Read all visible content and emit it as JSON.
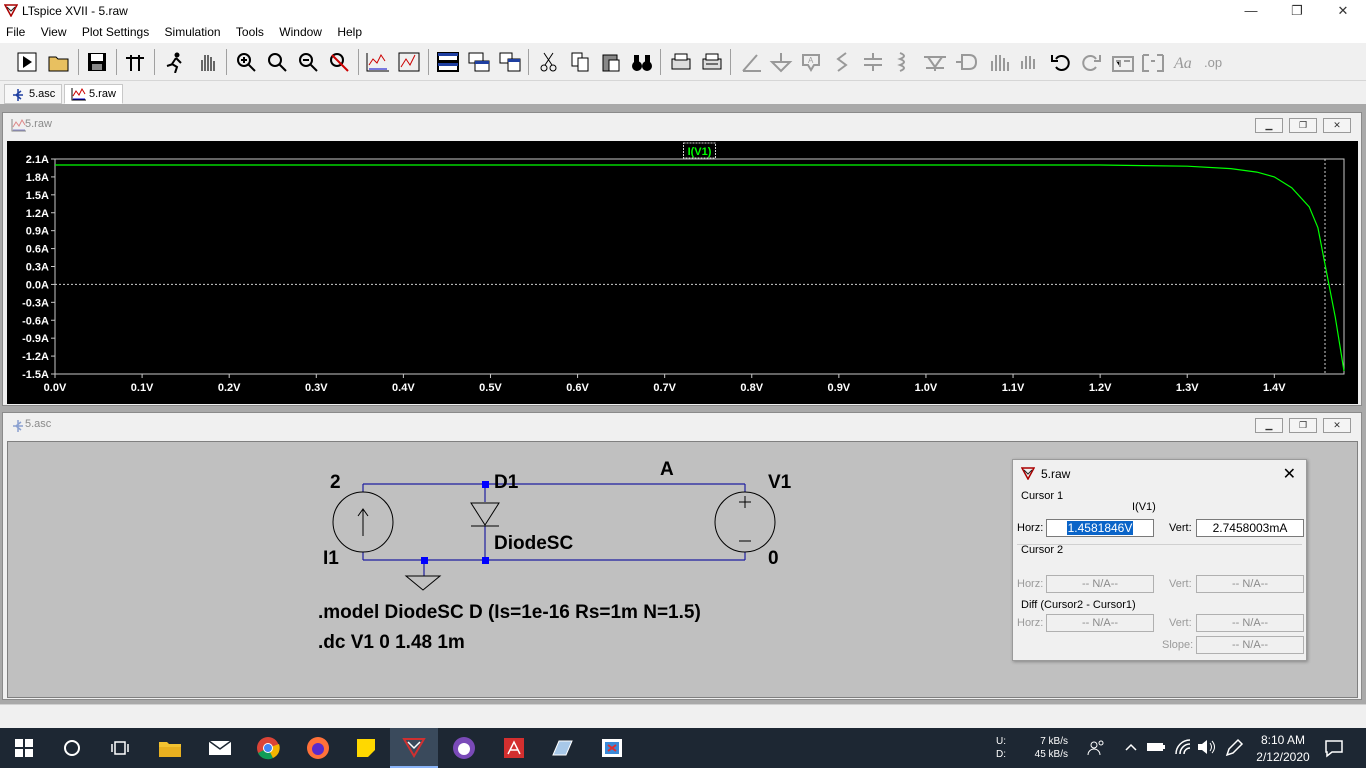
{
  "app": {
    "title": "LTspice XVII - 5.raw"
  },
  "window_controls": {
    "minimize": "—",
    "restore": "❐",
    "close": "✕"
  },
  "menu": [
    "File",
    "View",
    "Plot Settings",
    "Simulation",
    "Tools",
    "Window",
    "Help"
  ],
  "tabs": [
    {
      "label": "5.asc"
    },
    {
      "label": "5.raw"
    }
  ],
  "plot_window": {
    "title": "5.raw",
    "trace_label": "I(V1)"
  },
  "chart_data": {
    "type": "line",
    "series": [
      {
        "name": "I(V1)",
        "color": "#00ff00",
        "x": [
          0.0,
          0.2,
          0.4,
          0.6,
          0.8,
          1.0,
          1.1,
          1.2,
          1.25,
          1.3,
          1.35,
          1.38,
          1.4,
          1.42,
          1.44,
          1.45,
          1.46,
          1.47,
          1.48
        ],
        "y": [
          2.0,
          2.0,
          2.0,
          2.0,
          2.0,
          2.0,
          2.0,
          2.0,
          1.99,
          1.98,
          1.94,
          1.88,
          1.8,
          1.62,
          1.3,
          0.95,
          0.2,
          -0.55,
          -1.45
        ]
      }
    ],
    "yticks": [
      "2.1A",
      "1.8A",
      "1.5A",
      "1.2A",
      "0.9A",
      "0.6A",
      "0.3A",
      "0.0A",
      "-0.3A",
      "-0.6A",
      "-0.9A",
      "-1.2A",
      "-1.5A"
    ],
    "xticks": [
      "0.0V",
      "0.1V",
      "0.2V",
      "0.3V",
      "0.4V",
      "0.5V",
      "0.6V",
      "0.7V",
      "0.8V",
      "0.9V",
      "1.0V",
      "1.1V",
      "1.2V",
      "1.3V",
      "1.4V"
    ],
    "xlim": [
      0.0,
      1.48
    ],
    "ylim": [
      -1.5,
      2.1
    ],
    "cursor_x": 1.4581846,
    "zero_line": true
  },
  "schematic_window": {
    "title": "5.asc",
    "labels": {
      "node2": "2",
      "d1": "D1",
      "a": "A",
      "v1": "V1",
      "i1": "I1",
      "diode_model": "DiodeSC",
      "zero": "0"
    },
    "directives": [
      ".model DiodeSC D (Is=1e-16 Rs=1m N=1.5)",
      ".dc V1 0 1.48 1m"
    ]
  },
  "cursor_dialog": {
    "title": "5.raw",
    "close": "✕",
    "cursor1_label": "Cursor 1",
    "trace": "I(V1)",
    "horz_label": "Horz:",
    "vert_label": "Vert:",
    "c1_horz": "1.4581846V",
    "c1_vert": "2.7458003mA",
    "cursor2_label": "Cursor 2",
    "c2_horz": "-- N/A--",
    "c2_vert": "-- N/A--",
    "diff_label": "Diff (Cursor2 - Cursor1)",
    "diff_horz": "-- N/A--",
    "diff_vert": "-- N/A--",
    "slope_label": "Slope:",
    "slope": "-- N/A--"
  },
  "taskbar": {
    "net_u_label": "U:",
    "net_d_label": "D:",
    "net_u": "7 kB/s",
    "net_d": "45 kB/s",
    "time": "8:10 AM",
    "date": "2/12/2020"
  }
}
